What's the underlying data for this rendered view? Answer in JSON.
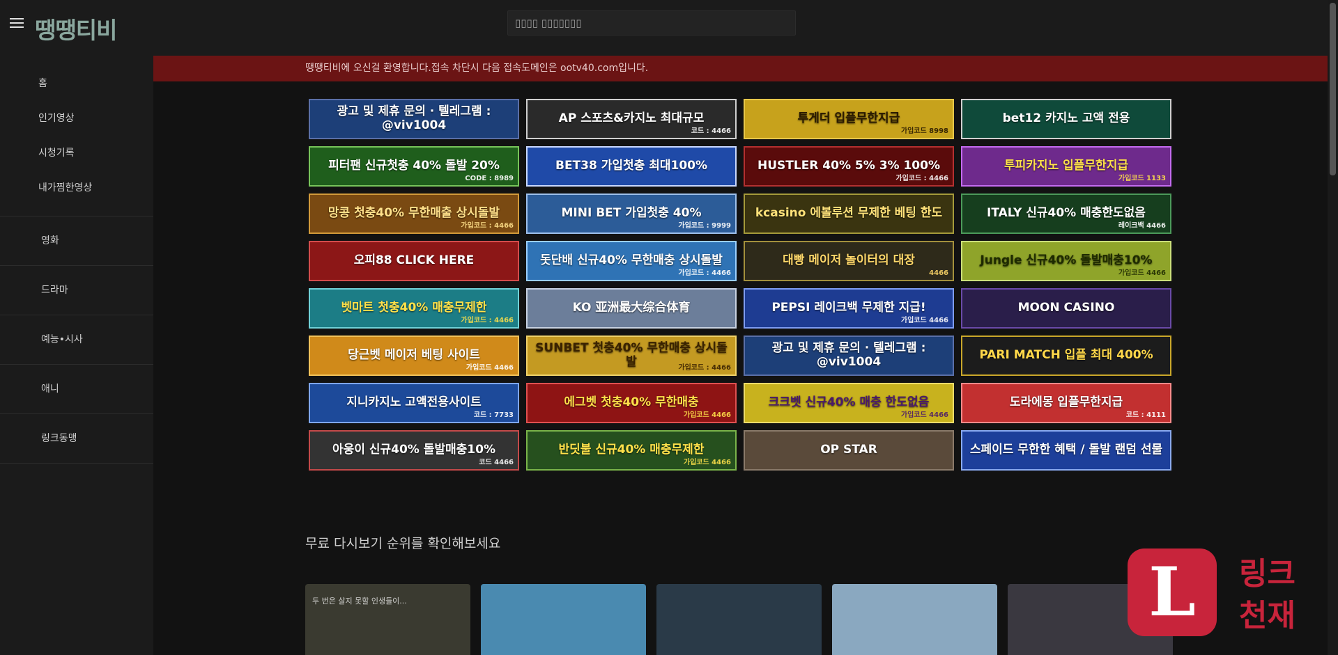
{
  "header": {
    "logo": "땡땡티비",
    "search_placeholder": "▯▯▯▯ ▯▯▯▯▯▯▯"
  },
  "sidebar": {
    "group1": [
      {
        "label": "홈"
      },
      {
        "label": "인기영상"
      },
      {
        "label": "시청기록"
      },
      {
        "label": "내가찜한영상"
      }
    ],
    "group2": [
      {
        "label": "영화"
      },
      {
        "label": "드라마"
      },
      {
        "label": "예능•시사"
      },
      {
        "label": "애니"
      },
      {
        "label": "링크동맹"
      }
    ]
  },
  "notice": {
    "text": "땡땡티비에 오신걸 환영합니다.접속 차단시 다음 접속도메인은 ootv40.com입니다."
  },
  "banners": [
    {
      "text": "광고 및 제휴 문의 · 텔레그램 : @viv1004",
      "bg": "#1d3f78",
      "border": "#5a6fa8",
      "color": "#ffffff"
    },
    {
      "text": "AP 스포츠&카지노 최대규모",
      "sub": "코드 : 4466",
      "bg": "#2a2a2a",
      "border": "#cfcfcf",
      "color": "#ffffff"
    },
    {
      "text": "투게더 입플무한지급",
      "sub": "가입코드 8998",
      "bg": "#c7a21c",
      "border": "#e8c84a",
      "color": "#2a1a00"
    },
    {
      "text": "bet12 카지노 고액 전용",
      "bg": "#0f4a3a",
      "border": "#cfcfcf",
      "color": "#ffffff"
    },
    {
      "text": "피터팬 신규첫충 40% 돌발 20%",
      "sub": "CODE : 8989",
      "bg": "#1f5e1c",
      "border": "#77c45a",
      "color": "#ffffff"
    },
    {
      "text": "BET38 가입첫충 최대100%",
      "bg": "#1f4aa8",
      "border": "#c9d8ff",
      "color": "#ffffff"
    },
    {
      "text": "HUSTLER 40% 5% 3% 100%",
      "sub": "가입코드 : 4466",
      "bg": "#5a0b0b",
      "border": "#b33030",
      "color": "#ffffff"
    },
    {
      "text": "투피카지노 입플무한지급",
      "sub": "가입코드 1133",
      "bg": "#6e2a8c",
      "border": "#c46bf0",
      "color": "#ffe14a"
    },
    {
      "text": "망콩 첫충40% 무한매출 상시돌발",
      "sub": "가입코드 : 4466",
      "bg": "#7a4a12",
      "border": "#d29a3a",
      "color": "#ffe08a"
    },
    {
      "text": "MINI BET 가입첫충 40%",
      "sub": "가입코드 : 9999",
      "bg": "#2c5c98",
      "border": "#9ec0ec",
      "color": "#ffffff"
    },
    {
      "text": "kcasino 에볼루션 무제한 베팅 한도",
      "bg": "#3a3410",
      "border": "#a49a3a",
      "color": "#ffe27a"
    },
    {
      "text": "ITALY 신규40% 매충한도없음",
      "sub": "레이크백 4466",
      "bg": "#163e1e",
      "border": "#4c9a5a",
      "color": "#ffffff"
    },
    {
      "text": "오피88 CLICK HERE",
      "bg": "#8c1717",
      "border": "#d44c4c",
      "color": "#ffffff"
    },
    {
      "text": "돗단배 신규40% 무한매충 상시돌발",
      "sub": "가입코드 : 4466",
      "bg": "#2f73b5",
      "border": "#9bd0ff",
      "color": "#ffffff"
    },
    {
      "text": "대빵 메이저 놀이터의 대장",
      "sub": "4466",
      "bg": "#2e2a1a",
      "border": "#a3903c",
      "color": "#ffd86a"
    },
    {
      "text": "Jungle 신규40% 돌발매충10%",
      "sub": "가입코드 4466",
      "bg": "#8fa42a",
      "border": "#cce07a",
      "color": "#1e2a00"
    },
    {
      "text": "벳마트 첫충40% 매충무제한",
      "sub": "가입코드 : 4466",
      "bg": "#1c7d86",
      "border": "#6fd2d8",
      "color": "#ffe14a"
    },
    {
      "text": "KO 亚洲最大综合体育",
      "bg": "#6c7e9a",
      "border": "#c8d2e2",
      "color": "#ffffff"
    },
    {
      "text": "PEPSI 레이크백 무제한 지급!",
      "sub": "가입코드 4466",
      "bg": "#1e3c92",
      "border": "#7e9cf2",
      "color": "#ffffff"
    },
    {
      "text": "MOON CASINO",
      "bg": "#2a1e4a",
      "border": "#6a4aa8",
      "color": "#ffffff"
    },
    {
      "text": "당근벳 메이저 베팅 사이트",
      "sub": "가입코드 4466",
      "bg": "#d08a1a",
      "border": "#f2c25a",
      "color": "#ffffff"
    },
    {
      "text": "SUNBET 첫충40% 무한매충 상시돌발",
      "sub": "가입코드 : 4466",
      "bg": "#c49a22",
      "border": "#f0d26a",
      "color": "#3a2200"
    },
    {
      "text": "광고 및 제휴 문의 · 텔레그램 : @viv1004",
      "bg": "#1d3f78",
      "border": "#5a6fa8",
      "color": "#ffffff"
    },
    {
      "text": "PARI MATCH 입플 최대 400%",
      "bg": "#1c1c1c",
      "border": "#c9a72a",
      "color": "#ffd84a"
    },
    {
      "text": "지니카지노 고액전용사이트",
      "sub": "코드 : 7733",
      "bg": "#1d4a9a",
      "border": "#7ea6ee",
      "color": "#ffffff"
    },
    {
      "text": "에그벳 첫충40% 무한매충",
      "sub": "가입코드 4466",
      "bg": "#8e1414",
      "border": "#e05050",
      "color": "#ffe14a"
    },
    {
      "text": "크크벳 신규40% 매충 한도없음",
      "sub": "가입코드 4466",
      "bg": "#c8b21e",
      "border": "#eddc6a",
      "color": "#4a1a6a"
    },
    {
      "text": "도라에몽 입플무한지급",
      "sub": "코드 : 4111",
      "bg": "#c23030",
      "border": "#ff8a8a",
      "color": "#ffffff"
    },
    {
      "text": "아웅이 신규40% 돌발매충10%",
      "sub": "코드 4466",
      "bg": "#333333",
      "border": "#c44a4a",
      "color": "#ffffff"
    },
    {
      "text": "반딧불 신규40% 매충무제한",
      "sub": "가입코드 4466",
      "bg": "#26501e",
      "border": "#7ab44a",
      "color": "#ffe14a"
    },
    {
      "text": "OP STAR",
      "bg": "#5a4a3a",
      "border": "#8a7a6a",
      "color": "#ffffff"
    },
    {
      "text": "스페이드 무한한 혜택 / 돌발 랜덤 선물",
      "bg": "#1d3f9a",
      "border": "#8aaaf0",
      "color": "#ffffff"
    }
  ],
  "section": {
    "title": "무료 다시보기 순위를 확인해보세요"
  },
  "posters": [
    {
      "caption": "두 번은 살지 못할 인생들이...",
      "bg": "#3a3a30"
    },
    {
      "caption": "",
      "bg": "#4a8ab0"
    },
    {
      "caption": "",
      "bg": "#2a3a48"
    },
    {
      "caption": "",
      "bg": "#8aa8c0"
    },
    {
      "caption": "",
      "bg": "#3a3840"
    }
  ],
  "watermark": {
    "letter": "L",
    "line1": "링크",
    "line2": "천재",
    "color": "#c8243b"
  }
}
